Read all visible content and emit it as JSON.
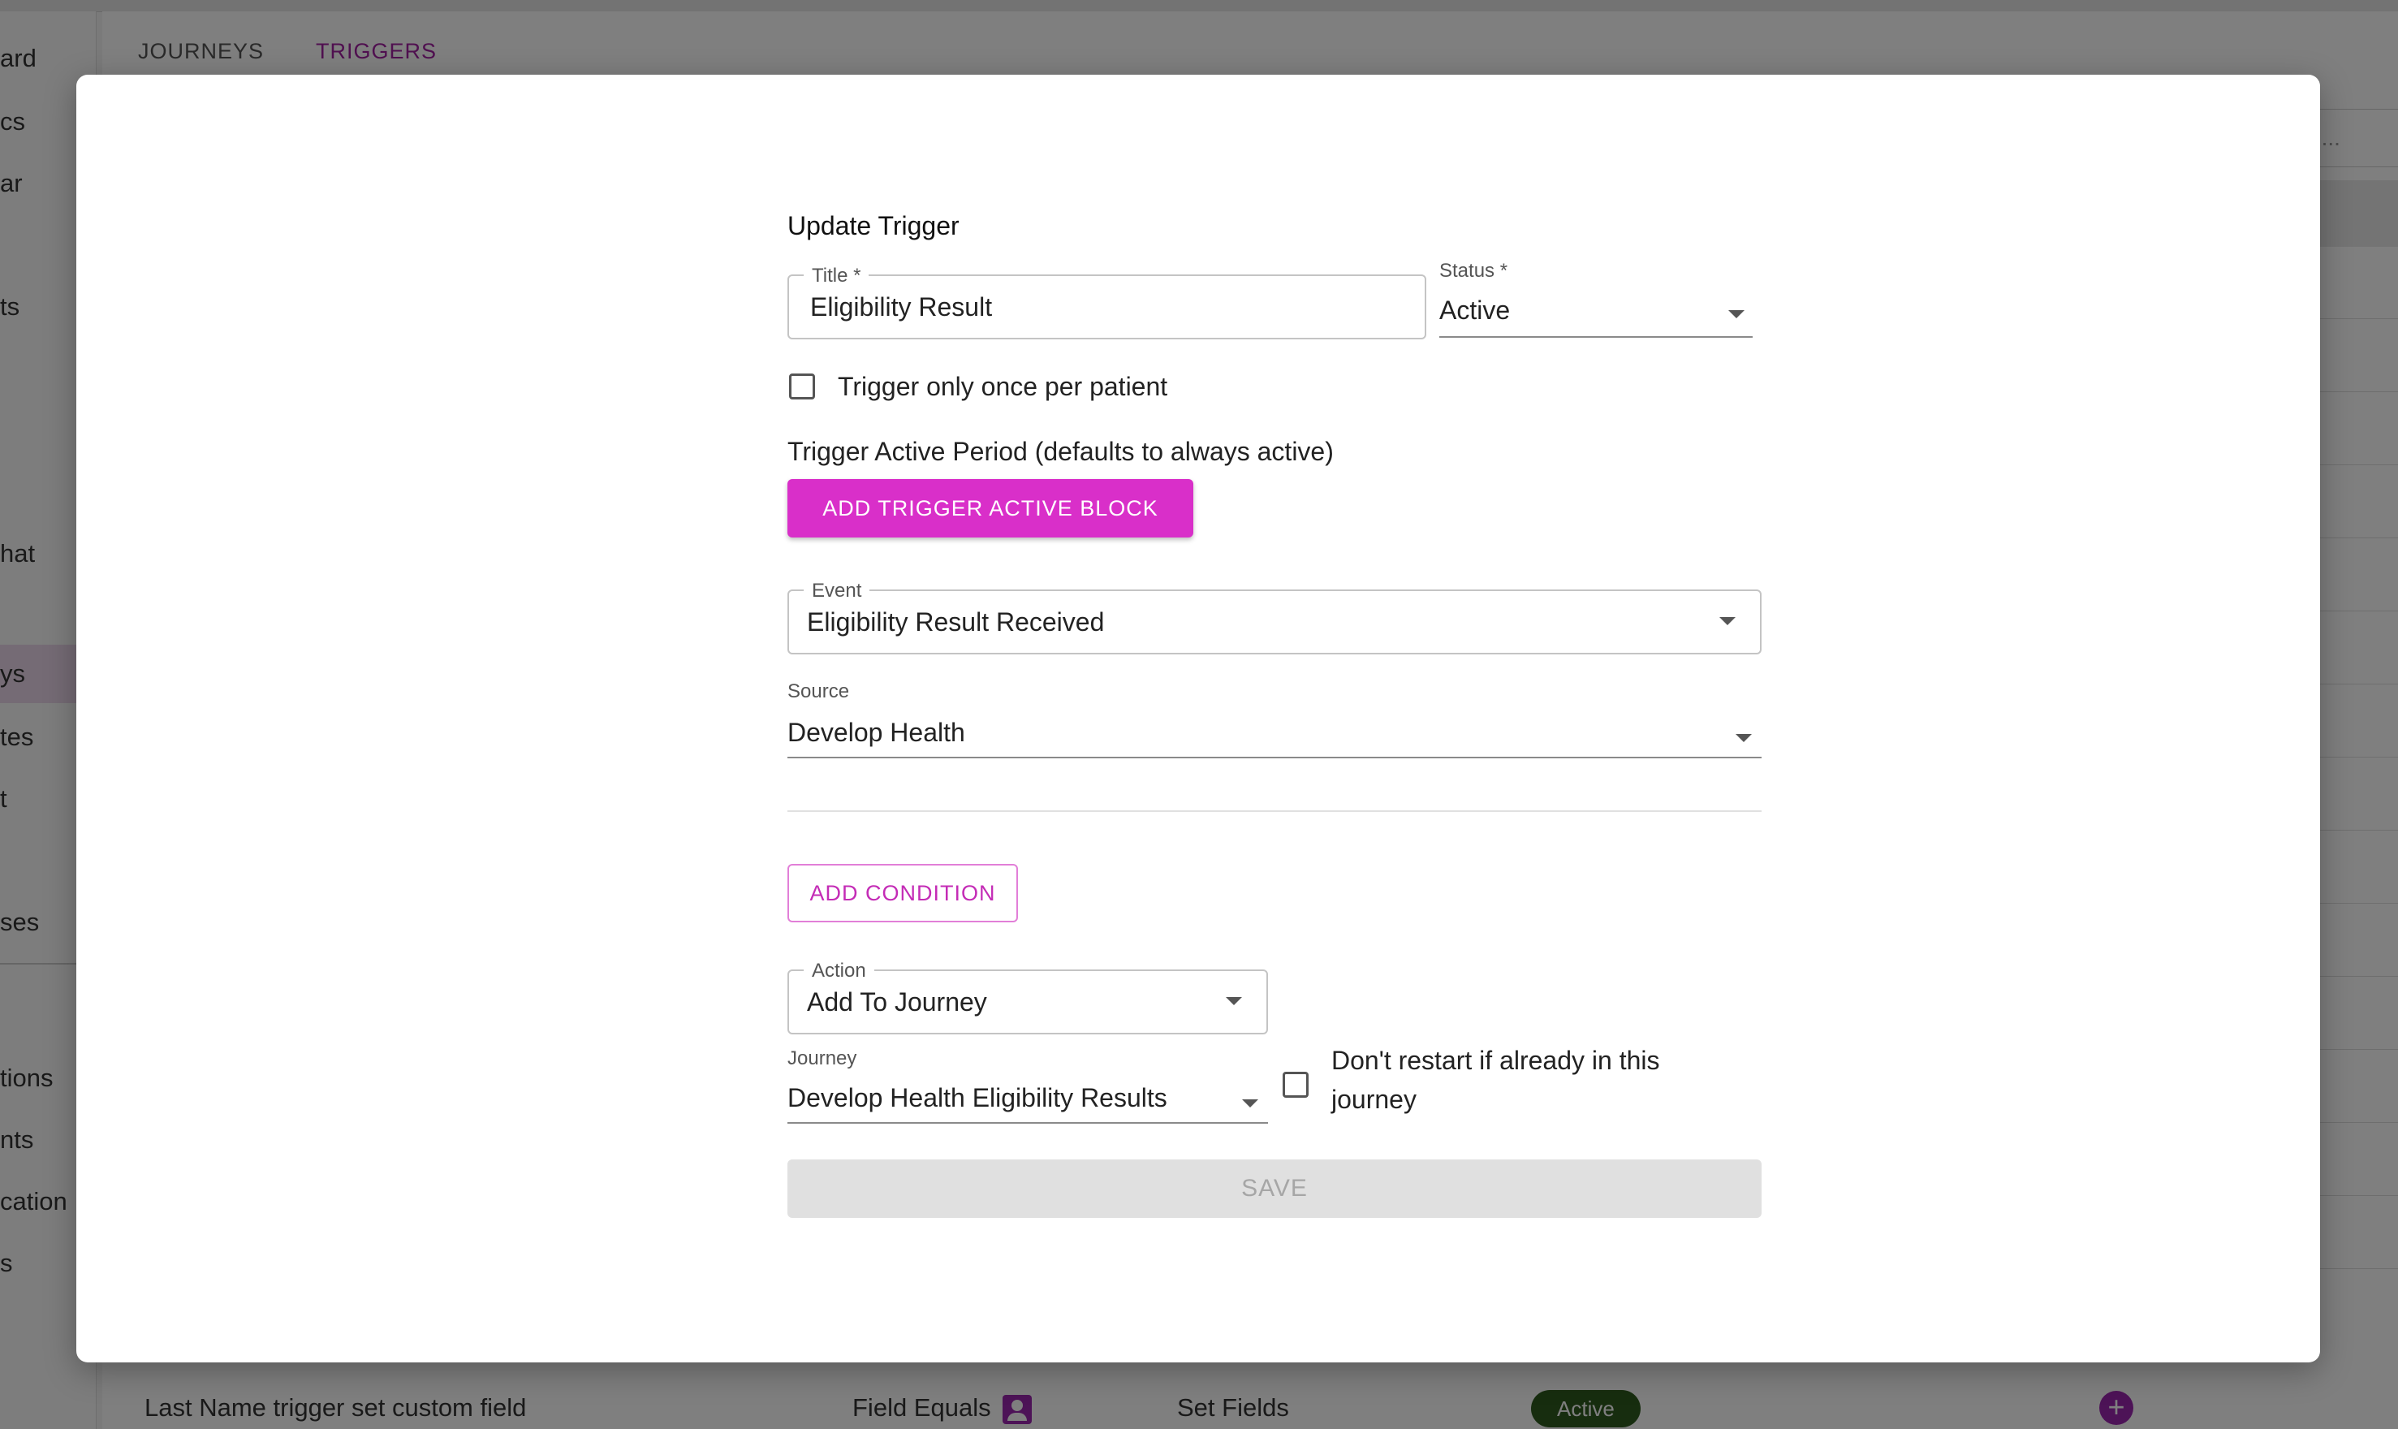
{
  "sidebar": {
    "items": [
      {
        "label": "ard"
      },
      {
        "label": "cs"
      },
      {
        "label": "ar"
      },
      {
        "label": "ts"
      },
      {
        "label": "hat"
      },
      {
        "label": "ys"
      },
      {
        "label": "tes"
      },
      {
        "label": "t"
      },
      {
        "label": "ses"
      },
      {
        "label": "tions"
      },
      {
        "label": "nts"
      },
      {
        "label": "cation"
      },
      {
        "label": "s"
      }
    ]
  },
  "tabs": [
    {
      "label": "JOURNEYS"
    },
    {
      "label": "TRIGGERS"
    }
  ],
  "search": {
    "fragment": "h..."
  },
  "bottom_row": {
    "name": "Last Name trigger set custom field",
    "event": "Field Equals",
    "action": "Set Fields",
    "status": "Active"
  },
  "dialog": {
    "title": "Update Trigger",
    "title_field": {
      "label": "Title *",
      "value": "Eligibility Result"
    },
    "status_field": {
      "label": "Status *",
      "value": "Active"
    },
    "once_checkbox": {
      "label": "Trigger only once per patient"
    },
    "active_period": {
      "label": "Trigger Active Period (defaults to always active)",
      "button": "ADD TRIGGER ACTIVE BLOCK"
    },
    "event_field": {
      "label": "Event",
      "value": "Eligibility Result Received"
    },
    "source_field": {
      "label": "Source",
      "value": "Develop Health"
    },
    "add_condition": "ADD CONDITION",
    "action_field": {
      "label": "Action",
      "value": "Add To Journey"
    },
    "journey_field": {
      "label": "Journey",
      "value": "Develop Health Eligibility Results"
    },
    "restart_checkbox": {
      "label_line1": "Don't restart if already in this",
      "label_line2": "journey"
    },
    "save": "SAVE"
  }
}
